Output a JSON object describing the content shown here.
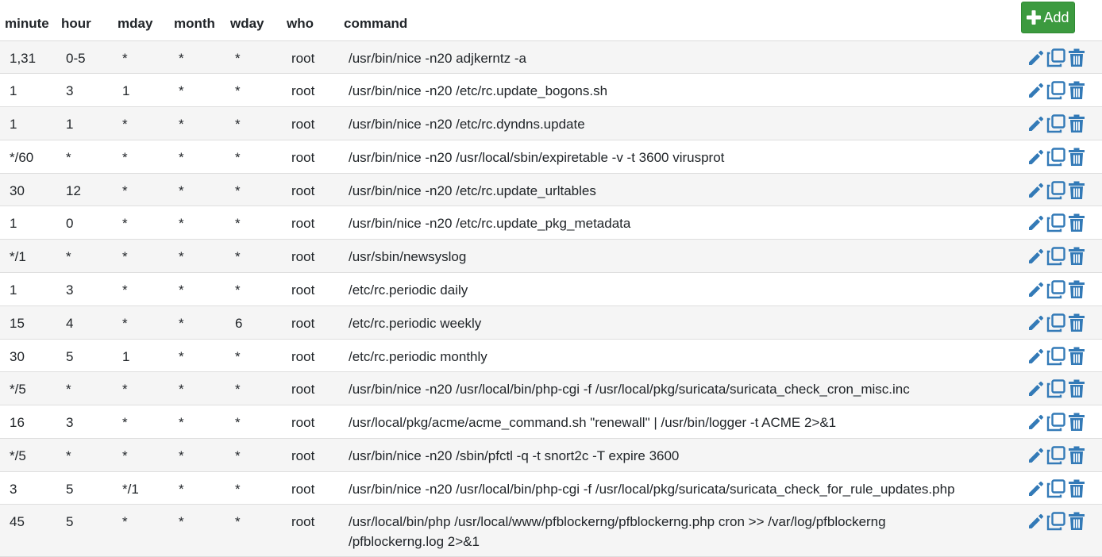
{
  "columns": {
    "minute": "minute",
    "hour": "hour",
    "mday": "mday",
    "month": "month",
    "wday": "wday",
    "who": "who",
    "command": "command"
  },
  "add_button": {
    "label": "Add",
    "icon": "plus-icon"
  },
  "action_icons": [
    "pencil-icon",
    "copy-icon",
    "trash-icon"
  ],
  "colors": {
    "accent": "#337ab7",
    "success": "#3c9a3f"
  },
  "rows": [
    {
      "minute": "1,31",
      "hour": "0-5",
      "mday": "*",
      "month": "*",
      "wday": "*",
      "who": "root",
      "command": "/usr/bin/nice -n20 adjkerntz -a"
    },
    {
      "minute": "1",
      "hour": "3",
      "mday": "1",
      "month": "*",
      "wday": "*",
      "who": "root",
      "command": "/usr/bin/nice -n20 /etc/rc.update_bogons.sh"
    },
    {
      "minute": "1",
      "hour": "1",
      "mday": "*",
      "month": "*",
      "wday": "*",
      "who": "root",
      "command": "/usr/bin/nice -n20 /etc/rc.dyndns.update"
    },
    {
      "minute": "*/60",
      "hour": "*",
      "mday": "*",
      "month": "*",
      "wday": "*",
      "who": "root",
      "command": "/usr/bin/nice -n20 /usr/local/sbin/expiretable -v -t 3600 virusprot"
    },
    {
      "minute": "30",
      "hour": "12",
      "mday": "*",
      "month": "*",
      "wday": "*",
      "who": "root",
      "command": "/usr/bin/nice -n20 /etc/rc.update_urltables"
    },
    {
      "minute": "1",
      "hour": "0",
      "mday": "*",
      "month": "*",
      "wday": "*",
      "who": "root",
      "command": "/usr/bin/nice -n20 /etc/rc.update_pkg_metadata"
    },
    {
      "minute": "*/1",
      "hour": "*",
      "mday": "*",
      "month": "*",
      "wday": "*",
      "who": "root",
      "command": "/usr/sbin/newsyslog"
    },
    {
      "minute": "1",
      "hour": "3",
      "mday": "*",
      "month": "*",
      "wday": "*",
      "who": "root",
      "command": "/etc/rc.periodic daily"
    },
    {
      "minute": "15",
      "hour": "4",
      "mday": "*",
      "month": "*",
      "wday": "6",
      "who": "root",
      "command": "/etc/rc.periodic weekly"
    },
    {
      "minute": "30",
      "hour": "5",
      "mday": "1",
      "month": "*",
      "wday": "*",
      "who": "root",
      "command": "/etc/rc.periodic monthly"
    },
    {
      "minute": "*/5",
      "hour": "*",
      "mday": "*",
      "month": "*",
      "wday": "*",
      "who": "root",
      "command": "/usr/bin/nice -n20 /usr/local/bin/php-cgi -f /usr/local/pkg/suricata/suricata_check_cron_misc.inc"
    },
    {
      "minute": "16",
      "hour": "3",
      "mday": "*",
      "month": "*",
      "wday": "*",
      "who": "root",
      "command": "/usr/local/pkg/acme/acme_command.sh \"renewall\" | /usr/bin/logger -t ACME 2>&1"
    },
    {
      "minute": "*/5",
      "hour": "*",
      "mday": "*",
      "month": "*",
      "wday": "*",
      "who": "root",
      "command": "/usr/bin/nice -n20 /sbin/pfctl -q -t snort2c -T expire 3600"
    },
    {
      "minute": "3",
      "hour": "5",
      "mday": "*/1",
      "month": "*",
      "wday": "*",
      "who": "root",
      "command": "/usr/bin/nice -n20 /usr/local/bin/php-cgi -f /usr/local/pkg/suricata/suricata_check_for_rule_updates.php"
    },
    {
      "minute": "45",
      "hour": "5",
      "mday": "*",
      "month": "*",
      "wday": "*",
      "who": "root",
      "command": "/usr/local/bin/php /usr/local/www/pfblockerng/pfblockerng.php cron >> /var/log/pfblockerng\n/pfblockerng.log 2>&1"
    }
  ]
}
